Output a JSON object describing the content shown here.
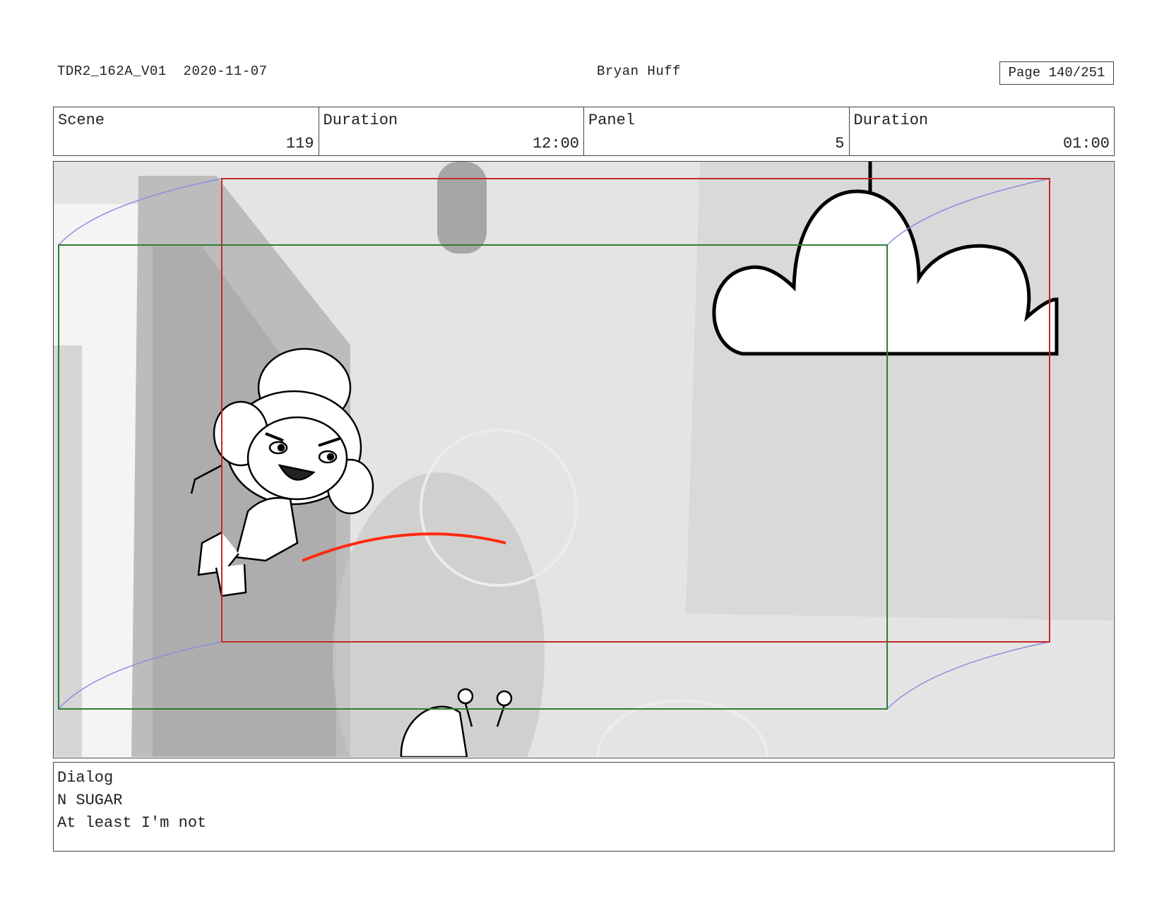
{
  "header": {
    "file_id": "TDR2_162A_V01",
    "date": "2020-11-07",
    "artist": "Bryan Huff",
    "page": "Page 140/251"
  },
  "info": {
    "scene_label": "Scene",
    "scene_value": "119",
    "scene_duration_label": "Duration",
    "scene_duration_value": "12:00",
    "panel_label": "Panel",
    "panel_value": "5",
    "panel_duration_label": "Duration",
    "panel_duration_value": "01:00"
  },
  "frame": {
    "colors": {
      "camera_start": "#2e7d32",
      "camera_end": "#c62828",
      "move_arrows": "#8c8ce0",
      "action_line": "#ff2a10"
    }
  },
  "dialog": {
    "label": "Dialog",
    "character": "N SUGAR",
    "line": "At least I'm not"
  }
}
